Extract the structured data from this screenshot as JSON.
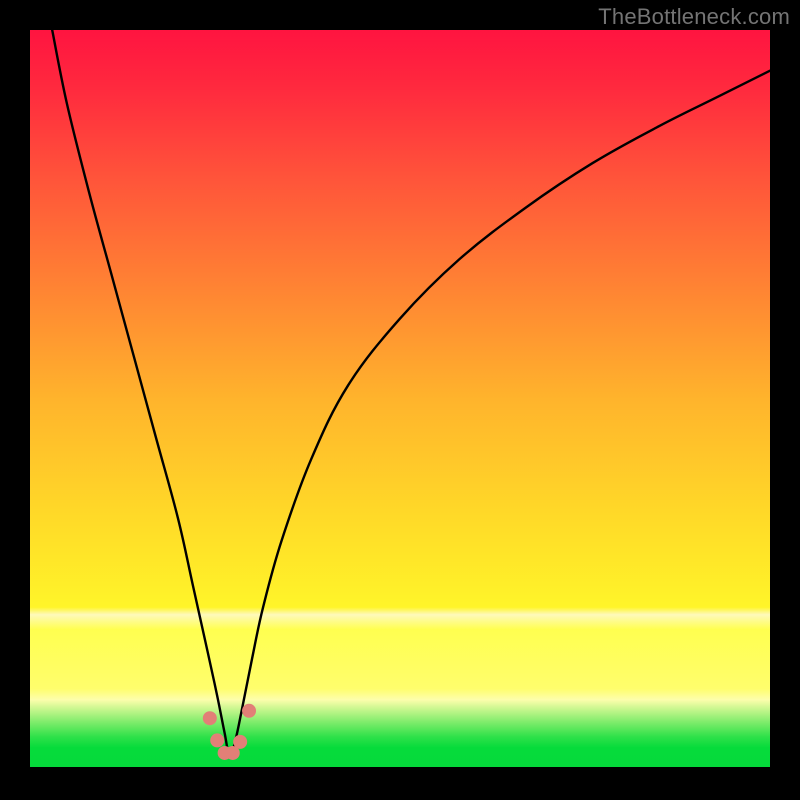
{
  "watermark": "TheBottleneck.com",
  "colors": {
    "black": "#000000",
    "curve": "#000000",
    "dot": "#e27f77",
    "gradient_stops": [
      {
        "offset": 0.0,
        "color": "#ff1440"
      },
      {
        "offset": 0.08,
        "color": "#ff2a3e"
      },
      {
        "offset": 0.2,
        "color": "#ff543a"
      },
      {
        "offset": 0.35,
        "color": "#ff8433"
      },
      {
        "offset": 0.5,
        "color": "#ffb42c"
      },
      {
        "offset": 0.65,
        "color": "#ffd828"
      },
      {
        "offset": 0.78,
        "color": "#fff529"
      },
      {
        "offset": 0.79,
        "color": "#fef9bb"
      },
      {
        "offset": 0.81,
        "color": "#ffff50"
      },
      {
        "offset": 0.89,
        "color": "#fffe6c"
      },
      {
        "offset": 0.905,
        "color": "#fdfeac"
      },
      {
        "offset": 0.915,
        "color": "#d3f894"
      },
      {
        "offset": 0.925,
        "color": "#aaf27f"
      },
      {
        "offset": 0.935,
        "color": "#80ec6c"
      },
      {
        "offset": 0.945,
        "color": "#58e75a"
      },
      {
        "offset": 0.955,
        "color": "#2fe14a"
      },
      {
        "offset": 0.97,
        "color": "#06db3b"
      },
      {
        "offset": 1.0,
        "color": "#05da3b"
      }
    ]
  },
  "chart_data": {
    "type": "line",
    "title": "",
    "xlabel": "",
    "ylabel": "",
    "xlim": [
      0,
      100
    ],
    "ylim": [
      0,
      100
    ],
    "notch_x": 27,
    "series": [
      {
        "name": "curve",
        "x": [
          3,
          5,
          8,
          11,
          14,
          17,
          20,
          22,
          24,
          25.3,
          26.3,
          27,
          27.8,
          28.7,
          30,
          31.5,
          34,
          38,
          43,
          50,
          58,
          67,
          76,
          85,
          93,
          100
        ],
        "y": [
          100,
          90,
          78,
          67,
          56,
          45,
          34,
          25,
          16,
          10,
          5,
          1.8,
          4.2,
          8.5,
          15,
          22,
          31,
          42,
          52,
          61,
          69,
          76,
          82,
          87,
          91,
          94.5
        ]
      }
    ],
    "dots": [
      {
        "x": 24.3,
        "y": 7.0
      },
      {
        "x": 25.3,
        "y": 4.0
      },
      {
        "x": 26.3,
        "y": 2.3
      },
      {
        "x": 27.4,
        "y": 2.3
      },
      {
        "x": 28.4,
        "y": 3.8
      },
      {
        "x": 29.6,
        "y": 8.0
      }
    ]
  }
}
